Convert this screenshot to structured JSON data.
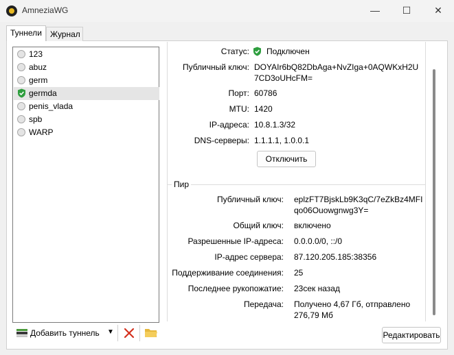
{
  "window": {
    "title": "AmneziaWG",
    "minimize": "—",
    "maximize": "☐",
    "close": "✕"
  },
  "tabs": {
    "tunnels": "Туннели",
    "journal": "Журнал"
  },
  "tunnels": [
    {
      "name": "123",
      "status": "off"
    },
    {
      "name": "abuz",
      "status": "off"
    },
    {
      "name": "germ",
      "status": "off"
    },
    {
      "name": "germda",
      "status": "on",
      "selected": true
    },
    {
      "name": "penis_vlada",
      "status": "off"
    },
    {
      "name": "spb",
      "status": "off"
    },
    {
      "name": "WARP",
      "status": "off"
    }
  ],
  "toolbar": {
    "add_label": "Добавить туннель",
    "chevron": "▼"
  },
  "interface": {
    "status_label": "Статус:",
    "status_value": "Подключен",
    "pubkey_label": "Публичный ключ:",
    "pubkey_line1": "DOYAIr6bQ82DbAga+NvZIga+0AQWKxH2U",
    "pubkey_line2": "7CD3oUHcFM=",
    "port_label": "Порт:",
    "port_value": "60786",
    "mtu_label": "MTU:",
    "mtu_value": "1420",
    "ip_label": "IP-адреса:",
    "ip_value": "10.8.1.3/32",
    "dns_label": "DNS-серверы:",
    "dns_value": "1.1.1.1, 1.0.0.1",
    "disconnect_label": "Отключить"
  },
  "peer": {
    "title": "Пир",
    "pubkey_label": "Публичный ключ:",
    "pubkey_line1": "eplzFT7BjskLb9K3qC/7eZkBz4MFI",
    "pubkey_line2": "qo06Ouowgnwg3Y=",
    "psk_label": "Общий ключ:",
    "psk_value": "включено",
    "allowed_label": "Разрешенные IP-адреса:",
    "allowed_value": "0.0.0.0/0, ::/0",
    "endpoint_label": "IP-адрес сервера:",
    "endpoint_value": "87.120.205.185:38356",
    "keepalive_label": "Поддерживание соединения:",
    "keepalive_value": "25",
    "handshake_label": "Последнее рукопожатие:",
    "handshake_value": "23сек назад",
    "transfer_label": "Передача:",
    "transfer_line1": "Получено 4,67 Гб, отправлено",
    "transfer_line2": "276,79 Мб"
  },
  "edit_label": "Редактировать",
  "colors": {
    "connected": "#2e9e3e",
    "delete": "#d4301e",
    "folder": "#e6b73c",
    "selected_bg": "#e5e5e5"
  },
  "icons": {
    "app": "amneziawg-logo-icon",
    "shield": "shield-check-icon",
    "delete": "x-icon",
    "export": "folder-icon",
    "add": "add-tunnel-icon"
  }
}
